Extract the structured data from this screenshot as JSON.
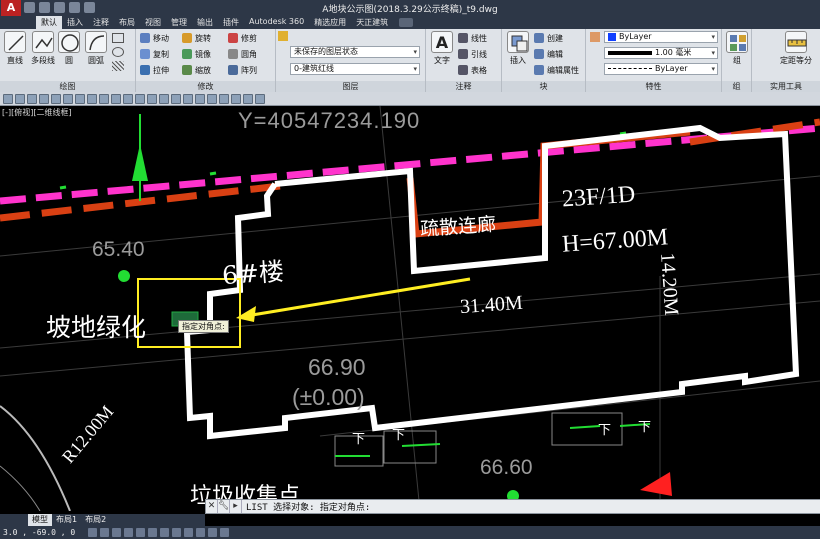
{
  "window": {
    "title": "A地块公示图(2018.3.29公示终稿)_t9.dwg",
    "app_button": "A"
  },
  "tabs": [
    "默认",
    "插入",
    "注释",
    "布局",
    "视图",
    "管理",
    "输出",
    "插件",
    "Autodesk 360",
    "精选应用",
    "天正建筑"
  ],
  "ribbon": {
    "draw": {
      "title": "绘图",
      "tools": [
        "直线",
        "多段线",
        "圆",
        "圆弧"
      ]
    },
    "modify": {
      "title": "修改",
      "tools": [
        "移动",
        "旋转",
        "修剪",
        "复制",
        "镜像",
        "圆角",
        "拉伸",
        "缩放",
        "阵列"
      ]
    },
    "layers": {
      "title": "图层",
      "state": "未保存的图层状态",
      "current_layer": "0-建筑红线"
    },
    "annotation": {
      "title": "注释",
      "big_tool": "文字",
      "tools": [
        "线性",
        "引线",
        "表格"
      ]
    },
    "block": {
      "title": "块",
      "big_tool": "插入",
      "tools": [
        "创建",
        "编辑",
        "编辑属性"
      ]
    },
    "properties": {
      "title": "特性",
      "color": "ByLayer",
      "lineweight": "1.00 毫米",
      "linetype": "ByLayer"
    },
    "group": {
      "big_tool": "组",
      "title": "组"
    },
    "utilities": {
      "big_tool": "定距等分",
      "title": "实用工具"
    }
  },
  "viewport": {
    "label": "[-][俯视][二维线框]"
  },
  "drawing": {
    "coordinate_text": "Y=40547234.190",
    "elevations": [
      "65.40",
      "66.90",
      "(±0.00)",
      "66.60"
    ],
    "building_name": "6#楼",
    "floors": "23F/1D",
    "height": "H=67.00M",
    "width_dim": "14.20M",
    "length_dim": "31.40M",
    "corridor": "疏散连廊",
    "green_label": "坡地绿化",
    "radius": "R12.00M",
    "bottom_label": "垃圾收集点",
    "down_labels": [
      "下",
      "下",
      "下",
      "下"
    ],
    "tooltip": "指定对角点:"
  },
  "command": {
    "text": "LIST 选择对象: 指定对角点:"
  },
  "layout_tabs": [
    "模型",
    "布局1",
    "布局2"
  ],
  "status": {
    "coordinates": "3.0 , -69.0 , 0"
  },
  "colors": {
    "magenta": "#ff33cc",
    "red_boundary": "#d94013",
    "white_outline": "#ffffff",
    "yellow": "#ffee22",
    "green": "#22dd33",
    "gray_text": "#9b9b9b"
  }
}
